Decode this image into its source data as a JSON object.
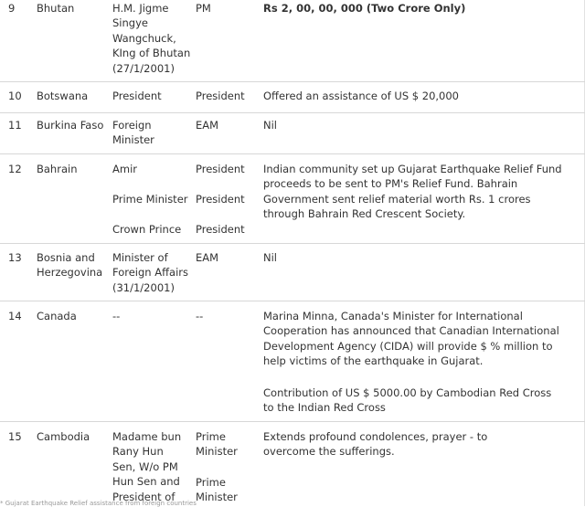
{
  "rows": [
    {
      "no": "9",
      "country": "Bhutan",
      "dignitary": "H.M. Jigme Singye Wangchuck, KIng of Bhutan (27/1/2001)",
      "recipient": "PM",
      "aid": "Rs 2, 00, 00, 000 (Two Crore Only)"
    },
    {
      "no": "10",
      "country": "Botswana",
      "dignitary": "President",
      "recipient": "President",
      "aid": "Offered an assistance of US $ 20,000"
    },
    {
      "no": "11",
      "country": "Burkina Faso",
      "dignitary": "Foreign Minister",
      "recipient": "EAM",
      "aid": "Nil"
    },
    {
      "no": "12",
      "country": "Bahrain",
      "dignitaries": [
        "Amir",
        "Prime Minister",
        "Crown Prince"
      ],
      "recipients": [
        "President",
        "President",
        "President"
      ],
      "aid": "Indian community set up Gujarat Earthquake Relief Fund proceeds to be sent to PM's Relief Fund. Bahrain Government sent relief material worth Rs. 1 crores through Bahrain Red Crescent Society."
    },
    {
      "no": "13",
      "country": "Bosnia and Herzegovina",
      "dignitary": "Minister of Foreign Affairs (31/1/2001)",
      "recipient": "EAM",
      "aid": "Nil"
    },
    {
      "no": "14",
      "country": "Canada",
      "dignitary": "--",
      "recipient": "--",
      "aid": "Marina Minna, Canada's Minister for International Cooperation has announced that Canadian International Development Agency (CIDA) will provide $ % million to help victims of the earthquake in Gujarat.",
      "aid2": "Contribution of US $ 5000.00 by Cambodian Red Cross to the Indian Red Cross"
    },
    {
      "no": "15",
      "country": "Cambodia",
      "dignitary": "Madame bun Rany Hun Sen, W/o PM Hun Sen and President of",
      "recipients": [
        "Prime Minister",
        "Prime Minister"
      ],
      "aid": "Extends profound condolences, prayer - to overcome the sufferings."
    }
  ],
  "footer": "* Gujarat Earthquake Relief assistance from foreign countries"
}
